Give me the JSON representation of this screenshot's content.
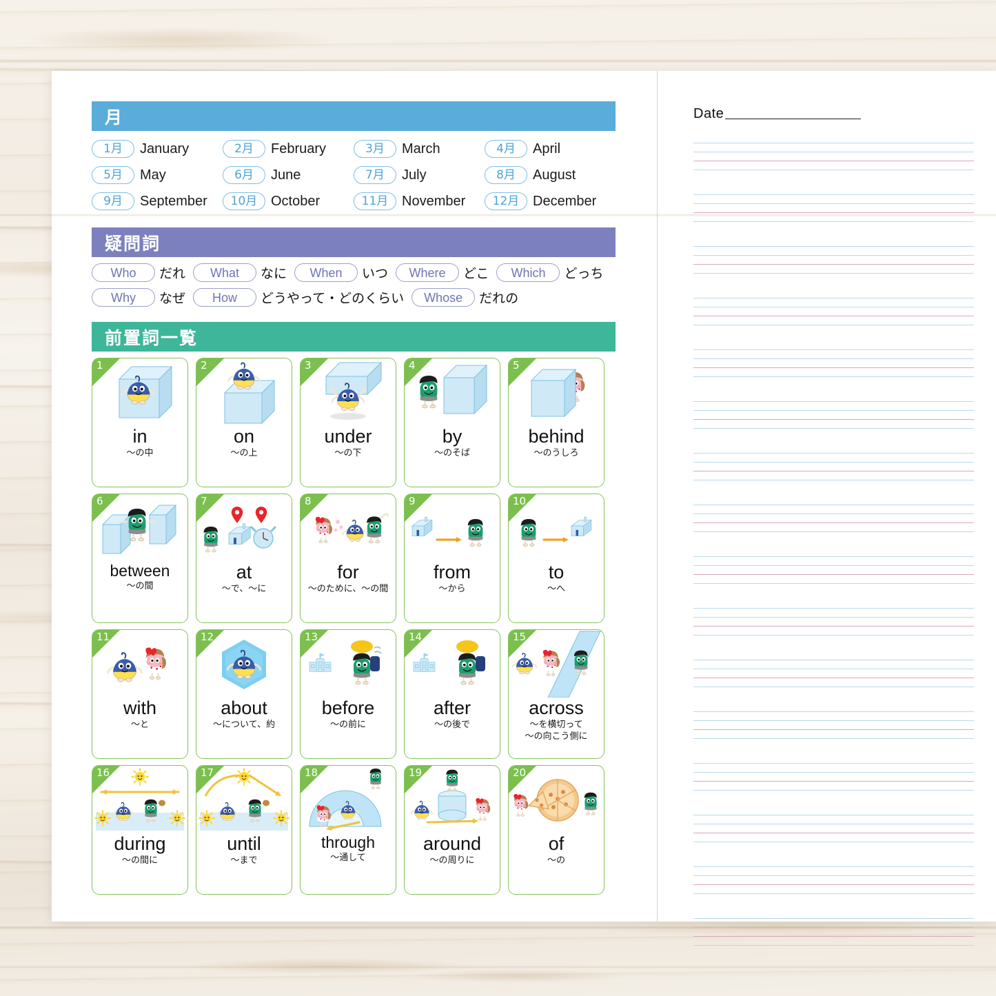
{
  "colors": {
    "months_bar": "#5aadda",
    "question_bar": "#7c81bd",
    "prep_bar": "#3eb69a",
    "card_border": "#86c35a",
    "card_corner": "#7cbf4e",
    "rule_blue": "#b9d9ea",
    "rule_pink": "#d9a8bd"
  },
  "left_page": {
    "months": {
      "heading": "月",
      "items": [
        {
          "badge": "1月",
          "en": "January"
        },
        {
          "badge": "2月",
          "en": "February"
        },
        {
          "badge": "3月",
          "en": "March"
        },
        {
          "badge": "4月",
          "en": "April"
        },
        {
          "badge": "5月",
          "en": "May"
        },
        {
          "badge": "6月",
          "en": "June"
        },
        {
          "badge": "7月",
          "en": "July"
        },
        {
          "badge": "8月",
          "en": "August"
        },
        {
          "badge": "9月",
          "en": "September"
        },
        {
          "badge": "10月",
          "en": "October"
        },
        {
          "badge": "11月",
          "en": "November"
        },
        {
          "badge": "12月",
          "en": "December"
        }
      ]
    },
    "question_words": {
      "heading": "疑問詞",
      "rows": [
        [
          {
            "en": "Who",
            "ja": "だれ"
          },
          {
            "en": "What",
            "ja": "なに"
          },
          {
            "en": "When",
            "ja": "いつ"
          },
          {
            "en": "Where",
            "ja": "どこ"
          },
          {
            "en": "Which",
            "ja": "どっち"
          }
        ],
        [
          {
            "en": "Why",
            "ja": "なぜ"
          },
          {
            "en": "How",
            "ja": "どうやって・どのくらい"
          },
          {
            "en": "Whose",
            "ja": "だれの"
          }
        ]
      ]
    },
    "prepositions": {
      "heading": "前置詞一覧",
      "cards": [
        {
          "num": "1",
          "word": "in",
          "gloss": "～の中",
          "art": "in"
        },
        {
          "num": "2",
          "word": "on",
          "gloss": "～の上",
          "art": "on"
        },
        {
          "num": "3",
          "word": "under",
          "gloss": "～の下",
          "art": "under"
        },
        {
          "num": "4",
          "word": "by",
          "gloss": "～のそば",
          "art": "by"
        },
        {
          "num": "5",
          "word": "behind",
          "gloss": "～のうしろ",
          "art": "behind"
        },
        {
          "num": "6",
          "word": "between",
          "gloss": "～の間",
          "art": "between"
        },
        {
          "num": "7",
          "word": "at",
          "gloss": "～で、～に",
          "art": "at"
        },
        {
          "num": "8",
          "word": "for",
          "gloss": "～のために、～の間",
          "art": "for"
        },
        {
          "num": "9",
          "word": "from",
          "gloss": "～から",
          "art": "from"
        },
        {
          "num": "10",
          "word": "to",
          "gloss": "～へ",
          "art": "to"
        },
        {
          "num": "11",
          "word": "with",
          "gloss": "～と",
          "art": "with"
        },
        {
          "num": "12",
          "word": "about",
          "gloss": "～について、約",
          "art": "about"
        },
        {
          "num": "13",
          "word": "before",
          "gloss": "～の前に",
          "art": "before"
        },
        {
          "num": "14",
          "word": "after",
          "gloss": "～の後で",
          "art": "after"
        },
        {
          "num": "15",
          "word": "across",
          "gloss": "～を横切って\n～の向こう側に",
          "art": "across"
        },
        {
          "num": "16",
          "word": "during",
          "gloss": "～の間に",
          "art": "during"
        },
        {
          "num": "17",
          "word": "until",
          "gloss": "～まで",
          "art": "until"
        },
        {
          "num": "18",
          "word": "through",
          "gloss": "～通して",
          "art": "through"
        },
        {
          "num": "19",
          "word": "around",
          "gloss": "～の周りに",
          "art": "around"
        },
        {
          "num": "20",
          "word": "of",
          "gloss": "～の",
          "art": "of"
        }
      ]
    }
  },
  "right_page": {
    "date_label": "Date",
    "date_value": "",
    "line_groups": 16,
    "lines_per_group": [
      "blue",
      "blue",
      "pink",
      "blue"
    ]
  }
}
